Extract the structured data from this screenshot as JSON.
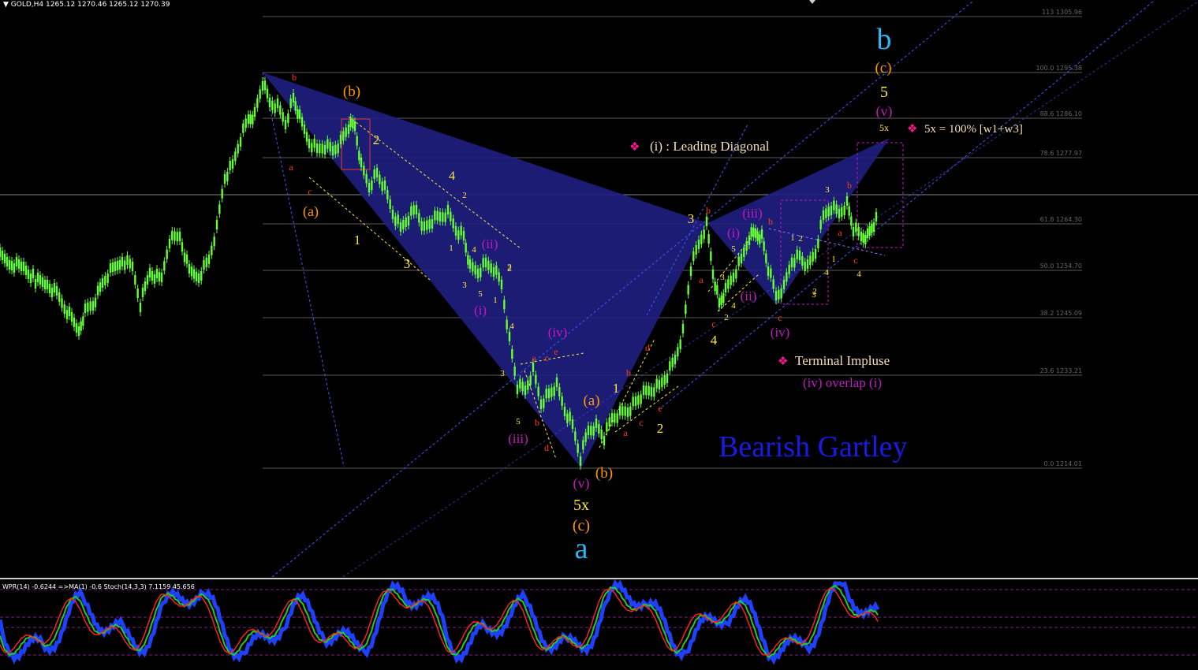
{
  "symbol_header": "GOLD,H4  1265.12 1270.46 1265.12 1270.39",
  "fib_levels": [
    {
      "label": "113 1305.96"
    },
    {
      "label": "100.0 1295.38"
    },
    {
      "label": "88.6 1286.10"
    },
    {
      "label": "78.6 1277.97"
    },
    {
      "label": "61.8 1264.30"
    },
    {
      "label": "50.0 1254.70"
    },
    {
      "label": "38.2 1245.09"
    },
    {
      "label": "23.6 1233.21"
    },
    {
      "label": "0.0 1214.01"
    }
  ],
  "pattern_title": "Bearish Gartley",
  "annotations": {
    "leading_diagonal": "(i) : Leading Diagonal",
    "target": "5x = 100% [w1+w3]",
    "terminal": "Terminal Impluse",
    "overlap": "(iv) overlap (i)"
  },
  "wave_labels": [
    {
      "text": "b",
      "color": "#29b6f6"
    },
    {
      "text": "(c)",
      "color": "#ff9800"
    },
    {
      "text": "5",
      "color": "#ffeb3b"
    },
    {
      "text": "(v)",
      "color": "#c218c2"
    },
    {
      "text": "5x",
      "color": "#ffeb3b"
    },
    {
      "text": "a",
      "color": "#29b6f6"
    },
    {
      "text": "(c)",
      "color": "#ff9800"
    },
    {
      "text": "5x",
      "color": "#ffeb3b"
    },
    {
      "text": "(v)",
      "color": "#c218c2"
    },
    {
      "text": "(b)",
      "color": "#ff9800"
    },
    {
      "text": "(a)",
      "color": "#ff9800"
    },
    {
      "text": "(b)",
      "color": "#ff9800"
    },
    {
      "text": "(a)",
      "color": "#ff9800"
    },
    {
      "text": "b",
      "color": "#ff3d00"
    },
    {
      "text": "a",
      "color": "#ff3d00"
    },
    {
      "text": "c",
      "color": "#ff3d00"
    },
    {
      "text": "2",
      "color": "#ffeb3b"
    },
    {
      "text": "1",
      "color": "#ffeb3b"
    },
    {
      "text": "3",
      "color": "#ffeb3b"
    },
    {
      "text": "4",
      "color": "#ffeb3b"
    },
    {
      "text": "2",
      "color": "#ffeb3b"
    },
    {
      "text": "(ii)",
      "color": "#c218c2"
    },
    {
      "text": "(i)",
      "color": "#c218c2"
    },
    {
      "text": "(iv)",
      "color": "#c218c2"
    },
    {
      "text": "(iii)",
      "color": "#c218c2"
    },
    {
      "text": "a",
      "color": "#ff3d00"
    },
    {
      "text": "c",
      "color": "#ff3d00"
    },
    {
      "text": "e",
      "color": "#ff3d00"
    },
    {
      "text": "b",
      "color": "#ff3d00"
    },
    {
      "text": "d",
      "color": "#ff3d00"
    },
    {
      "text": "1",
      "color": "#ffeb3b"
    },
    {
      "text": "2",
      "color": "#ffeb3b"
    },
    {
      "text": "b",
      "color": "#ff3d00"
    },
    {
      "text": "d",
      "color": "#ff3d00"
    },
    {
      "text": "a",
      "color": "#ff3d00"
    },
    {
      "text": "c",
      "color": "#ff3d00"
    },
    {
      "text": "e",
      "color": "#ff3d00"
    },
    {
      "text": "3",
      "color": "#ffeb3b"
    },
    {
      "text": "b",
      "color": "#ff3d00"
    },
    {
      "text": "a",
      "color": "#ff3d00"
    },
    {
      "text": "c",
      "color": "#ff3d00"
    },
    {
      "text": "4",
      "color": "#ffeb3b"
    },
    {
      "text": "(i)",
      "color": "#c218c2"
    },
    {
      "text": "(ii)",
      "color": "#c218c2"
    },
    {
      "text": "(iii)",
      "color": "#c218c2"
    },
    {
      "text": "(iv)",
      "color": "#c218c2"
    },
    {
      "text": "b",
      "color": "#ff3d00"
    },
    {
      "text": "c",
      "color": "#ff3d00"
    },
    {
      "text": "b",
      "color": "#ff3d00"
    },
    {
      "text": "a",
      "color": "#ff3d00"
    },
    {
      "text": "c",
      "color": "#ff3d00"
    }
  ],
  "small_labels": [
    {
      "text": "2",
      "color": "#ffeb3b"
    },
    {
      "text": "1",
      "color": "#ffeb3b"
    },
    {
      "text": "4",
      "color": "#ffeb3b"
    },
    {
      "text": "3",
      "color": "#ffeb3b"
    },
    {
      "text": "5",
      "color": "#ffeb3b"
    },
    {
      "text": "2",
      "color": "#ffeb3b"
    },
    {
      "text": "1",
      "color": "#ffeb3b"
    },
    {
      "text": "4",
      "color": "#ffeb3b"
    },
    {
      "text": "3",
      "color": "#ffeb3b"
    },
    {
      "text": "5",
      "color": "#ffeb3b"
    },
    {
      "text": "5",
      "color": "#ffeb3b"
    },
    {
      "text": "3",
      "color": "#ffeb3b"
    },
    {
      "text": "4",
      "color": "#ffeb3b"
    },
    {
      "text": "2",
      "color": "#ffeb3b"
    },
    {
      "text": "1",
      "color": "#ffeb3b"
    },
    {
      "text": "3",
      "color": "#ffeb3b"
    },
    {
      "text": "4",
      "color": "#ffeb3b"
    },
    {
      "text": "2",
      "color": "#ffeb3b"
    },
    {
      "text": "1",
      "color": "#ffeb3b"
    },
    {
      "text": "2",
      "color": "#ffeb3b"
    },
    {
      "text": "3",
      "color": "#ffeb3b"
    },
    {
      "text": "4",
      "color": "#ffeb3b"
    }
  ],
  "indicator_label": "WPR(14) -0.6244  =>MA(1) -0.6  Stoch(14,3,3) 7.1159 45.656",
  "colors": {
    "background": "#000000",
    "candle": "#66ff33",
    "pattern_fill": "#1e1e7e",
    "fib_line": "#5a5a5a",
    "dotted_blue": "#3d5afe",
    "title_blue": "#1a1ae6",
    "annotation_pink": "#ff1493"
  }
}
